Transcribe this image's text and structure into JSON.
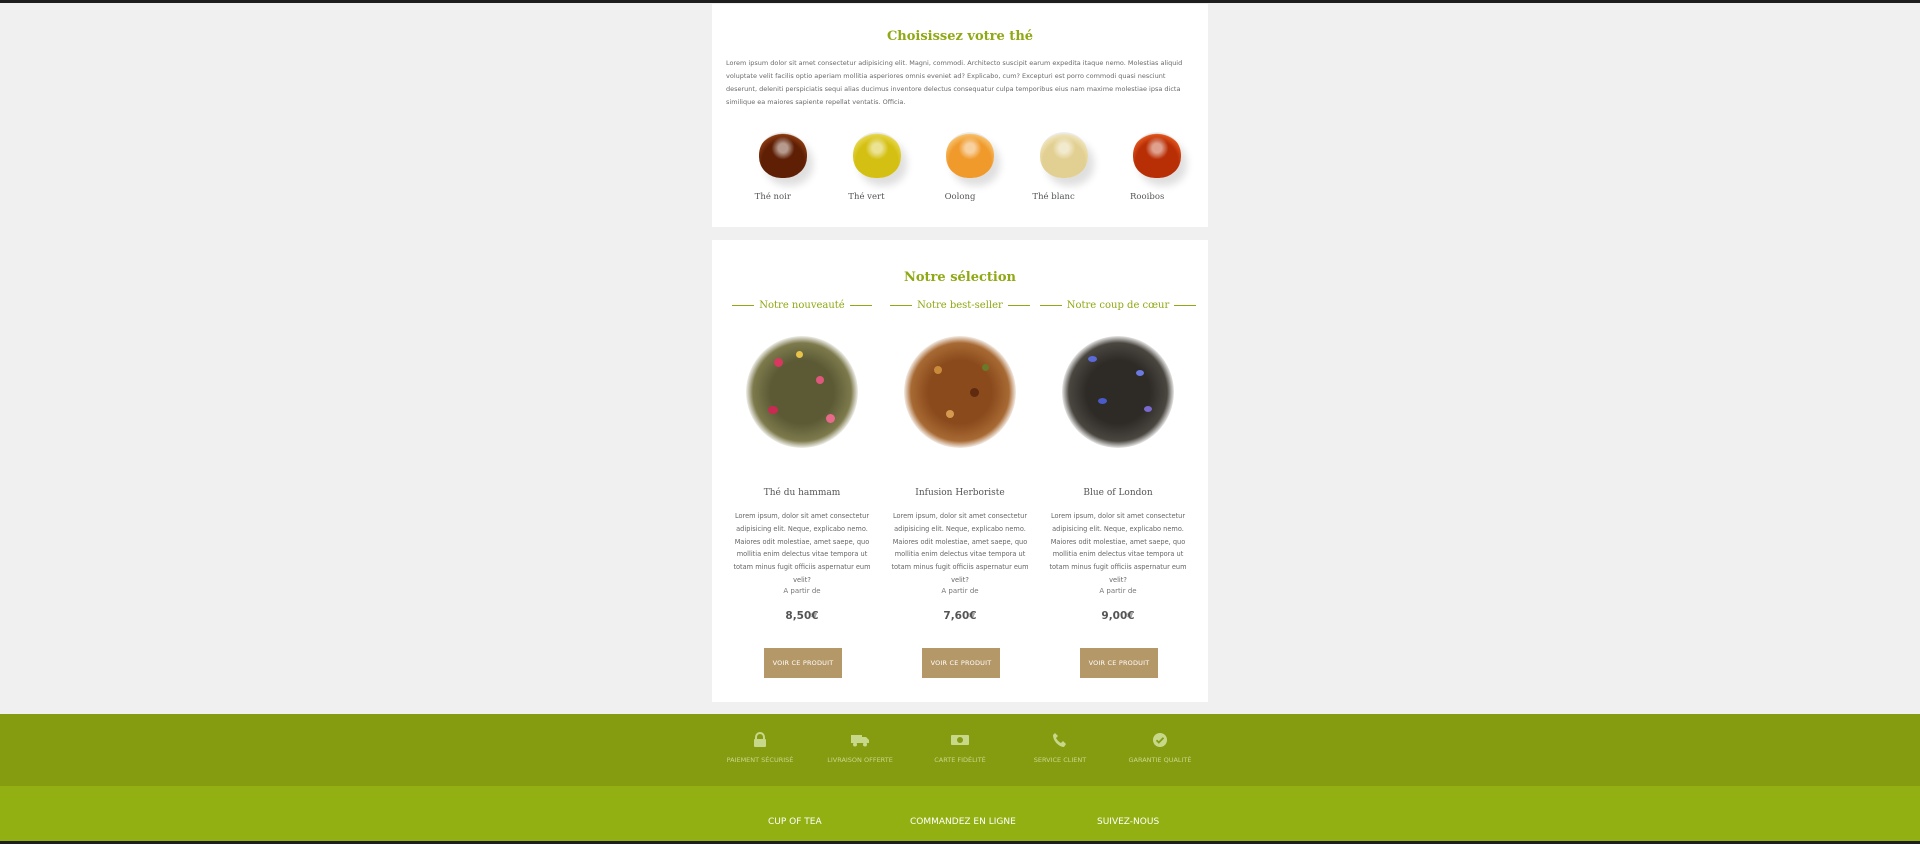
{
  "choose_section": {
    "title": "Choisissez votre thé",
    "intro": "Lorem ipsum dolor sit amet consectetur adipisicing elit. Magni, commodi. Architecto suscipit earum expedita itaque nemo. Molestias aliquid voluptate velit facilis optio aperiam mollitia asperiores omnis eveniet ad? Explicabo, cum? Excepturi est porro commodi quasi nesciunt deserunt, deleniti perspiciatis sequi alias ducimus inventore delectus consequatur culpa temporibus eius nam maxime molestiae ipsa dicta similique ea maiores sapiente repellat ventatis. Officia.",
    "types": [
      {
        "label": "Thé noir",
        "color": "#6e2a08"
      },
      {
        "label": "Thé vert",
        "color": "#d9c418"
      },
      {
        "label": "Oolong",
        "color": "#f2a23a"
      },
      {
        "label": "Thé blanc",
        "color": "#e8d8a0"
      },
      {
        "label": "Rooibos",
        "color": "#c53a0a"
      }
    ]
  },
  "selection_section": {
    "title": "Notre sélection",
    "products": [
      {
        "badge": "Notre nouveauté",
        "name": "Thé du hammam",
        "description": "Lorem ipsum, dolor sit amet consectetur adipisicing elit. Neque, explicabo nemo. Maiores odit molestiae, amet saepe, quo mollitia enim delectus vitae tempora ut totam minus fugit officiis aspernatur eum velit?",
        "from_label": "A partir de",
        "price": "8,50€",
        "button_label": "VOIR CE PRODUIT"
      },
      {
        "badge": "Notre best-seller",
        "name": "Infusion Herboriste",
        "description": "Lorem ipsum, dolor sit amet consectetur adipisicing elit. Neque, explicabo nemo. Maiores odit molestiae, amet saepe, quo mollitia enim delectus vitae tempora ut totam minus fugit officiis aspernatur eum velit?",
        "from_label": "A partir de",
        "price": "7,60€",
        "button_label": "VOIR CE PRODUIT"
      },
      {
        "badge": "Notre coup de cœur",
        "name": "Blue of London",
        "description": "Lorem ipsum, dolor sit amet consectetur adipisicing elit. Neque, explicabo nemo. Maiores odit molestiae, amet saepe, quo mollitia enim delectus vitae tempora ut totam minus fugit officiis aspernatur eum velit?",
        "from_label": "A partir de",
        "price": "9,00€",
        "button_label": "VOIR CE PRODUIT"
      }
    ]
  },
  "features": [
    {
      "icon": "lock-icon",
      "label": "PAIEMENT SÉCURISÉ"
    },
    {
      "icon": "truck-icon",
      "label": "LIVRAISON OFFERTE"
    },
    {
      "icon": "banknote-icon",
      "label": "CARTE FIDÉLITÉ"
    },
    {
      "icon": "phone-icon",
      "label": "SERVICE CLIENT"
    },
    {
      "icon": "check-circle-icon",
      "label": "GARANTIE QUALITÉ"
    }
  ],
  "footer": {
    "links": [
      "CUP OF TEA",
      "COMMANDEZ EN LIGNE",
      "SUIVEZ-NOUS"
    ]
  },
  "colors": {
    "accent": "#8ea913",
    "button": "#b59868",
    "features_band": "#859b10",
    "footer_band": "#93b012"
  }
}
